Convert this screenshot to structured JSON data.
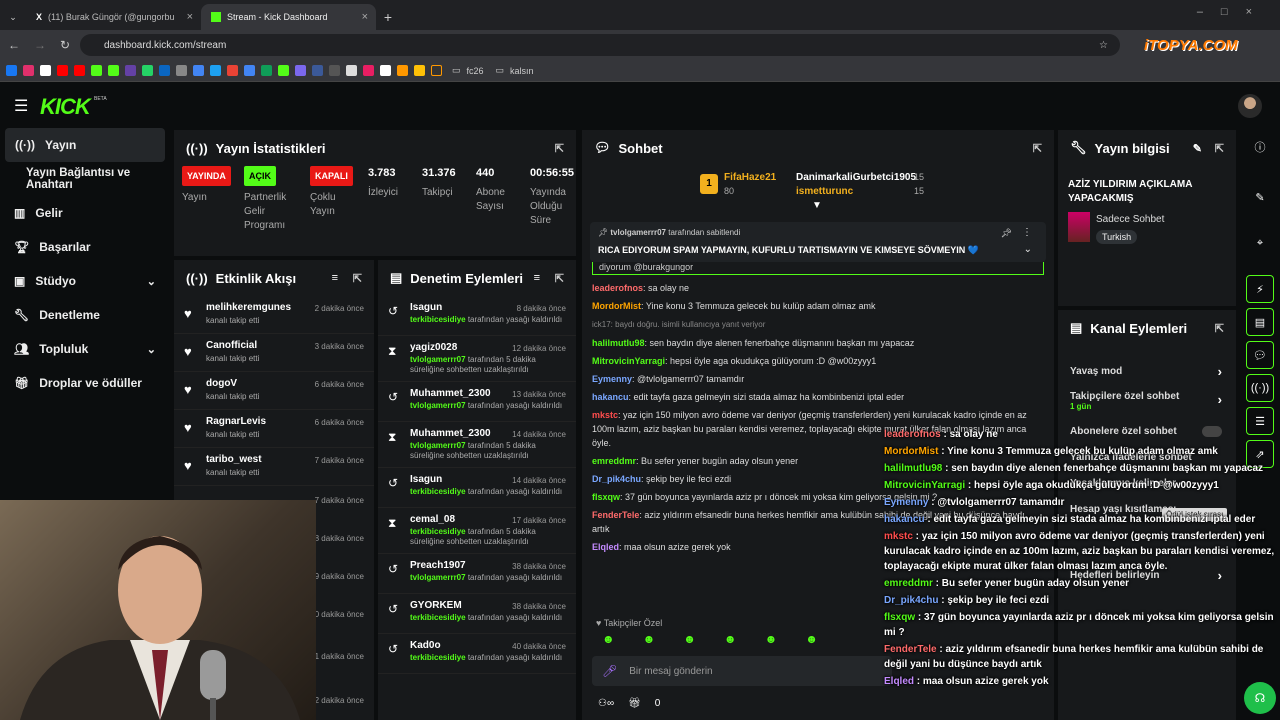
{
  "browser": {
    "tabs": [
      {
        "label": "(11) Burak Güngör (@gungorbu"
      },
      {
        "label": "Stream - Kick Dashboard"
      }
    ],
    "url": "dashboard.kick.com/stream",
    "bookmarks": [
      "fc26",
      "kalsın"
    ],
    "watermark": "iTOPYA.COM"
  },
  "brand": {
    "logo": "KICK",
    "beta": "BETA"
  },
  "sidebar": {
    "items": [
      {
        "label": "Yayın"
      },
      {
        "label": "Yayın Bağlantısı ve Anahtarı"
      },
      {
        "label": "Gelir"
      },
      {
        "label": "Başarılar"
      },
      {
        "label": "Stüdyo"
      },
      {
        "label": "Denetleme"
      },
      {
        "label": "Topluluk"
      },
      {
        "label": "Droplar ve ödüller"
      }
    ]
  },
  "stats": {
    "title": "Yayın İstatistikleri",
    "items": [
      {
        "badge": "YAYINDA",
        "badge_color": "#e91916",
        "label": "Yayın"
      },
      {
        "badge": "AÇIK",
        "badge_color": "#53fc18",
        "label": "Partnerlik Gelir Programı"
      },
      {
        "badge": "KAPALI",
        "badge_color": "#e91916",
        "label": "Çoklu Yayın"
      },
      {
        "value": "3.783",
        "label": "İzleyici"
      },
      {
        "value": "31.376",
        "label": "Takipçi"
      },
      {
        "value": "440",
        "label": "Abone Sayısı"
      },
      {
        "value": "00:56:55",
        "label": "Yayında Olduğu Süre"
      }
    ]
  },
  "activity": {
    "title": "Etkinlik Akışı",
    "items": [
      {
        "name": "melihkeremgunes",
        "sub": "kanalı takip etti",
        "time": "2 dakika önce"
      },
      {
        "name": "Canofficial",
        "sub": "kanalı takip etti",
        "time": "3 dakika önce"
      },
      {
        "name": "dogoV",
        "sub": "kanalı takip etti",
        "time": "6 dakika önce"
      },
      {
        "name": "RagnarLevis",
        "sub": "kanalı takip etti",
        "time": "6 dakika önce"
      },
      {
        "name": "taribo_west",
        "sub": "kanalı takip etti",
        "time": "7 dakika önce"
      }
    ],
    "partial_times": [
      "7 dakika önce",
      "8 dakika önce",
      "9 dakika önce",
      "10 dakika önce",
      "11 dakika önce",
      "12 dakika önce"
    ]
  },
  "moderation": {
    "title": "Denetim Eylemleri",
    "items": [
      {
        "icon": "↺",
        "name": "Isagun",
        "by": "terkibicesidiye",
        "text": "tarafından yasağı kaldırıldı",
        "time": "8 dakika önce"
      },
      {
        "icon": "⧗",
        "name": "yagiz0028",
        "by": "tvlolgamerrr07",
        "text": "tarafından 5 dakika süreliğine sohbetten uzaklaştırıldı",
        "time": "12 dakika önce"
      },
      {
        "icon": "↺",
        "name": "Muhammet_2300",
        "by": "tvlolgamerrr07",
        "text": "tarafından yasağı kaldırıldı",
        "time": "13 dakika önce"
      },
      {
        "icon": "⧗",
        "name": "Muhammet_2300",
        "by": "tvlolgamerrr07",
        "text": "tarafından 5 dakika süreliğine sohbetten uzaklaştırıldı",
        "time": "14 dakika önce"
      },
      {
        "icon": "↺",
        "name": "Isagun",
        "by": "terkibicesidiye",
        "text": "tarafından yasağı kaldırıldı",
        "time": "14 dakika önce"
      },
      {
        "icon": "⧗",
        "name": "cemal_08",
        "by": "terkibicesidiye",
        "text": "tarafından 5 dakika süreliğine sohbetten uzaklaştırıldı",
        "time": "17 dakika önce"
      },
      {
        "icon": "↺",
        "name": "Preach1907",
        "by": "tvlolgamerrr07",
        "text": "tarafından yasağı kaldırıldı",
        "time": "38 dakika önce"
      },
      {
        "icon": "↺",
        "name": "GYORKEM",
        "by": "terkibicesidiye",
        "text": "tarafından yasağı kaldırıldı",
        "time": "38 dakika önce"
      },
      {
        "icon": "↺",
        "name": "Kad0o",
        "by": "terkibicesidiye",
        "text": "tarafından yasağı kaldırıldı",
        "time": "40 dakika önce"
      }
    ]
  },
  "chat": {
    "title": "Sohbet",
    "top_gifters": [
      {
        "name": "FifaHaze21",
        "amount": "80"
      },
      {
        "name": "DanimarkaliGurbetci1905",
        "amount": "15"
      },
      {
        "name": "ismetturunc",
        "amount": "15"
      }
    ],
    "pinned_by": "tvlolgamerrr07",
    "pinned_suffix": "tarafından sabitlendi",
    "pinned_text": "RICA EDIYORUM SPAM YAPMAYIN, KUFURLU TARTISMAYIN VE KIMSEYE SÖVMEYIN 💙",
    "reply_fragment": "diyorum @burakgungor",
    "messages": [
      {
        "user": "leaderofnos",
        "color": "#ff6b6b",
        "text": "sa olay ne"
      },
      {
        "user": "MordorMist",
        "color": "#ffa500",
        "text": "Yine konu 3 Temmuza gelecek bu kulüp adam olmaz amk"
      },
      {
        "user": "",
        "color": "#888",
        "text": "ick17: baydı doğru. isimli kullanıcıya yanıt veriyor"
      },
      {
        "user": "halilmutlu98",
        "color": "#53fc18",
        "text": "sen baydın diye alenen fenerbahçe düşmanını başkan mı yapacaz"
      },
      {
        "user": "MitrovicinYarragi",
        "color": "#53fc18",
        "text": "hepsi öyle aga okudukça gülüyorum :D @w00zyyy1"
      },
      {
        "user": "Eymenny",
        "color": "#7aa7ff",
        "text": "@tvlolgamerrr07 tamamdır"
      },
      {
        "user": "hakancu",
        "color": "#7aa7ff",
        "text": "edit tayfa gaza gelmeyin sizi stada almaz ha kombinbenizi iptal eder"
      },
      {
        "user": "mkstc",
        "color": "#ff4d4d",
        "text": "yaz için 150 milyon avro ödeme var deniyor (geçmiş transferlerden) yeni kurulacak kadro içinde en az 100m lazım, aziz başkan bu paraları kendisi veremez, toplayacağı ekipte murat ülker falan olması lazım anca öyle."
      },
      {
        "user": "emreddmr",
        "color": "#53fc18",
        "text": "Bu sefer yener bugün aday olsun yener"
      },
      {
        "user": "Dr_pik4chu",
        "color": "#7aa7ff",
        "text": "şekip bey ile feci ezdi"
      },
      {
        "user": "flsxqw",
        "color": "#53fc18",
        "text": "37 gün boyunca yayınlarda aziz pr ı döncek mi yoksa kim geliyorsa gelsin mi ?"
      },
      {
        "user": "FenderTele",
        "color": "#ff6b6b",
        "text": "aziz yıldırım efsanedir buna herkes hemfikir ama kulübün sahibi de değil yani bu düşünce baydı artık"
      },
      {
        "user": "Elqled",
        "color": "#c48bff",
        "text": "maa olsun azize gerek yok"
      }
    ],
    "followers_only": "Takipçiler Özel",
    "input_placeholder": "Bir mesaj gönderin",
    "points": "0"
  },
  "info": {
    "title": "Yayın bilgisi",
    "stream_title": "AZİZ YILDIRIM AÇIKLAMA YAPACAKMIŞ",
    "category": "Sadece Sohbet",
    "tag": "Turkish"
  },
  "channel": {
    "title": "Kanal Eylemleri",
    "items": [
      {
        "label": "Yavaş mod",
        "sub": ""
      },
      {
        "label": "Takipçilere özel sohbet",
        "sub": "1 gün"
      },
      {
        "label": "Abonelere özel sohbet",
        "sub": ""
      },
      {
        "label": "Yalnızca ifadelerle sohbet",
        "sub": ""
      },
      {
        "label": "Yasaklanmış kelimeler",
        "sub": ""
      },
      {
        "label": "Hesap yaşı kısıtlaması",
        "sub": ""
      },
      {
        "label": "Hedefleri belirleyin",
        "sub": ""
      }
    ],
    "tooltip": "Ödül istek sırası"
  }
}
